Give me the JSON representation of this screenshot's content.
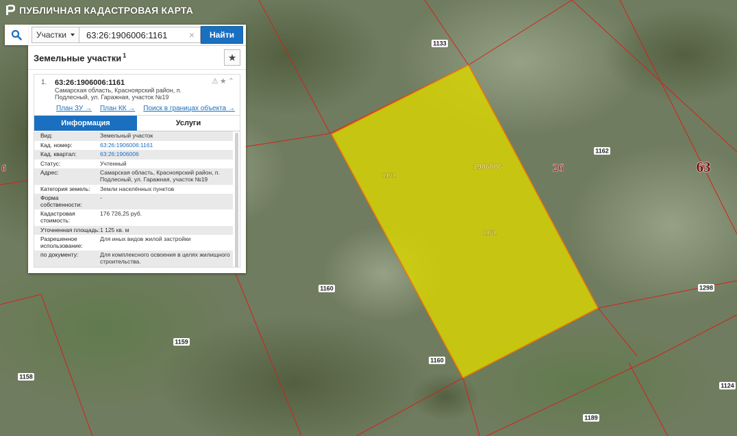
{
  "header": {
    "title": "ПУБЛИЧНАЯ КАДАСТРОВАЯ КАРТА"
  },
  "search": {
    "type_label": "Участки",
    "query": "63:26:1906006:1161",
    "button_label": "Найти"
  },
  "results": {
    "title": "Земельные участки",
    "count": "1",
    "item": {
      "index": "1.",
      "cadastral_number": "63:26:1906006:1161",
      "address": "Самарская область, Красноярский район, п. Подлесный, ул. Гаражная, участок №19",
      "links": [
        "План ЗУ →",
        "План КК →",
        "Поиск в границах объекта →"
      ],
      "tabs": [
        "Информация",
        "Услуги"
      ],
      "rows": [
        {
          "k": "Вид:",
          "v": "Земельный участок"
        },
        {
          "k": "Кад. номер:",
          "v": "63:26:1906006:1161"
        },
        {
          "k": "Кад. квартал:",
          "v": "63:26:1906006"
        },
        {
          "k": "Статус:",
          "v": "Учтенный"
        },
        {
          "k": "Адрес:",
          "v": "Самарская область, Красноярский район, п. Подлесный, ул. Гаражная, участок №19"
        },
        {
          "k": "Категория земель:",
          "v": "Земли населённых пунктов"
        },
        {
          "k": "Форма собственности:",
          "v": "-"
        },
        {
          "k": "Кадастровая стоимость:",
          "v": "176 726,25 руб."
        },
        {
          "k": "Уточненная площадь:",
          "v": "1 125 кв. м"
        },
        {
          "k": "Разрешенное использование:",
          "v": "Для иных видов жилой застройки"
        },
        {
          "k": "по документу:",
          "v": "Для комплексного освоения в целях жилищного строительства."
        }
      ]
    }
  },
  "map_labels": {
    "l1133": "1133",
    "l1162": "1162",
    "l1160a": "1160",
    "l1160b": "1160",
    "l1159": "1159",
    "l1158": "1158",
    "l1189": "1189",
    "l1124": "1124",
    "l1298": "1298",
    "l1161a": "1161",
    "l1161b": "1161",
    "l1906006": "1906006",
    "l26": "26",
    "l63": "63",
    "l6": "6"
  },
  "colors": {
    "accent": "#1a6fc0",
    "parcel_fill": "#d9d600",
    "boundary": "#d42020"
  }
}
